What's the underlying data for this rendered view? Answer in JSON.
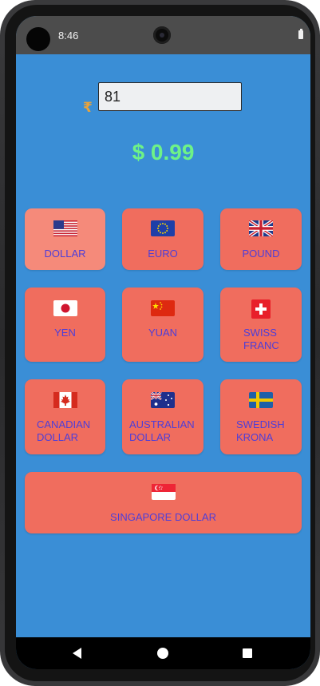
{
  "status_bar": {
    "time": "8:46"
  },
  "converter": {
    "currency_symbol": "₹",
    "amount_value": "81",
    "result_text": "$ 0.99"
  },
  "currencies": [
    {
      "label": "DOLLAR",
      "flag": "us-flag-icon",
      "selected": true
    },
    {
      "label": "EURO",
      "flag": "eu-flag-icon",
      "selected": false
    },
    {
      "label": "POUND",
      "flag": "uk-flag-icon",
      "selected": false
    },
    {
      "label": "YEN",
      "flag": "japan-flag-icon",
      "selected": false
    },
    {
      "label": "YUAN",
      "flag": "china-flag-icon",
      "selected": false
    },
    {
      "label": "SWISS\nFRANC",
      "flag": "switzerland-flag-icon",
      "selected": false
    },
    {
      "label": "CANADIAN\nDOLLAR",
      "flag": "canada-flag-icon",
      "selected": false
    },
    {
      "label": "AUSTRALIAN\nDOLLAR",
      "flag": "australia-flag-icon",
      "selected": false
    },
    {
      "label": "SWEDISH\nKRONA",
      "flag": "sweden-flag-icon",
      "selected": false
    },
    {
      "label": "SINGAPORE DOLLAR",
      "flag": "singapore-flag-icon",
      "selected": false
    }
  ],
  "colors": {
    "background": "#3a8ed6",
    "button": "#f06d5e",
    "button_selected": "#f58a7a",
    "label": "#4e3ed8",
    "result": "#6ef287"
  },
  "nav_bar": {
    "icons": [
      "back-icon",
      "home-icon",
      "recents-icon"
    ]
  }
}
